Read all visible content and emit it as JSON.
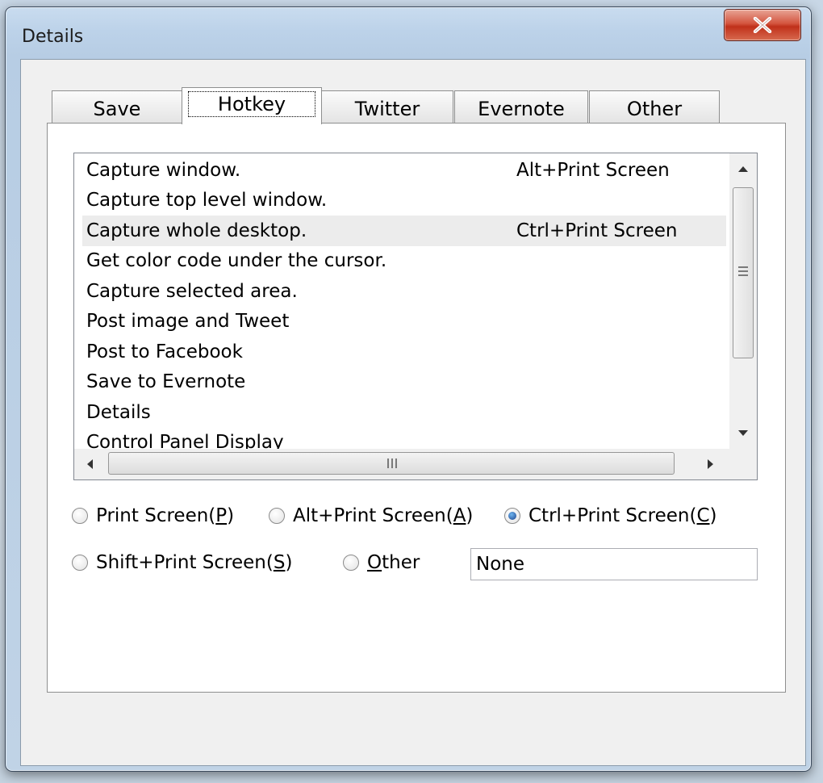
{
  "window": {
    "title": "Details"
  },
  "tabs": [
    {
      "label": "Save"
    },
    {
      "label": "Hotkey"
    },
    {
      "label": "Twitter"
    },
    {
      "label": "Evernote"
    },
    {
      "label": "Other"
    }
  ],
  "active_tab": "Hotkey",
  "hotkey_list": {
    "rows": [
      {
        "command": "Capture window.",
        "hotkey": "Alt+Print Screen"
      },
      {
        "command": "Capture top level window.",
        "hotkey": ""
      },
      {
        "command": "Capture whole desktop.",
        "hotkey": "Ctrl+Print Screen"
      },
      {
        "command": "Get color code under the cursor.",
        "hotkey": ""
      },
      {
        "command": "Capture selected area.",
        "hotkey": ""
      },
      {
        "command": "Post image and Tweet",
        "hotkey": ""
      },
      {
        "command": "Post to Facebook",
        "hotkey": ""
      },
      {
        "command": "Save to Evernote",
        "hotkey": ""
      },
      {
        "command": "Details",
        "hotkey": ""
      },
      {
        "command": "Control Panel Display",
        "hotkey": ""
      }
    ],
    "selected_row": "Capture whole desktop."
  },
  "radios": {
    "print_screen": {
      "pre": "Print Screen(",
      "key": "P",
      "post": ")"
    },
    "alt_print_screen": {
      "pre": "Alt+Print Screen(",
      "key": "A",
      "post": ")"
    },
    "ctrl_print_screen": {
      "pre": "Ctrl+Print Screen(",
      "key": "C",
      "post": ")"
    },
    "shift_print_screen": {
      "pre": "Shift+Print Screen(",
      "key": "S",
      "post": ")"
    },
    "other": {
      "pre": "",
      "key": "O",
      "post": "ther"
    },
    "selected": "Ctrl+Print Screen(C)"
  },
  "other_hotkey_field": {
    "value": "None"
  },
  "colors": {
    "selected_row": "#ececec",
    "close_button": "#c0301a"
  }
}
